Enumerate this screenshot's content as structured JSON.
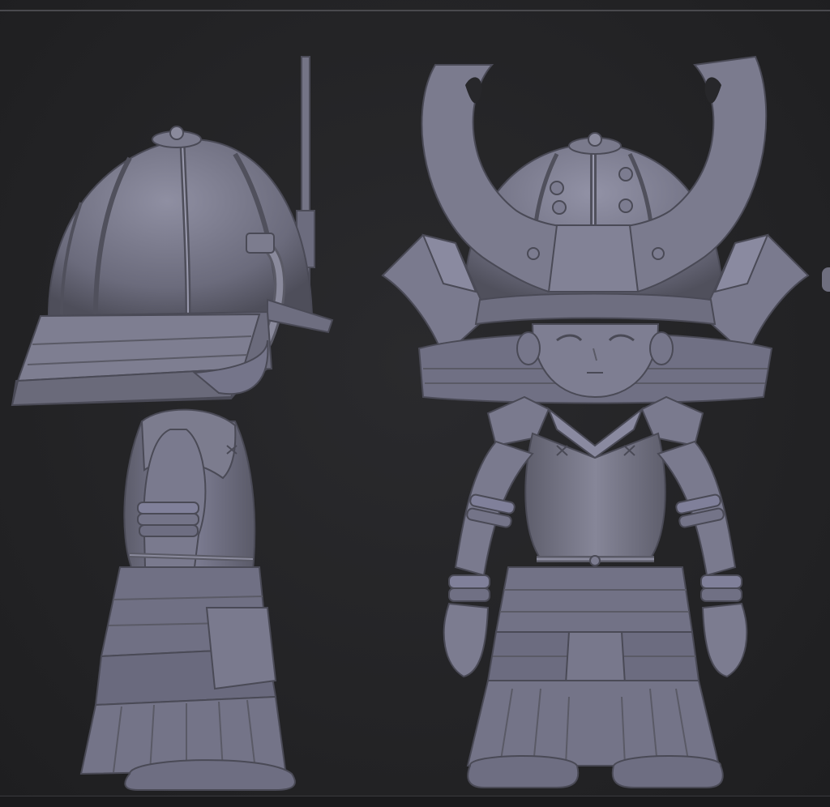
{
  "colors": {
    "background": "#252527",
    "clay_base": "#757586",
    "clay_light": "#9a9aab",
    "clay_dark": "#4a4a56",
    "clay_shadow": "#3a3a44"
  },
  "viewport": {
    "views": [
      {
        "id": "side",
        "icon": "samurai-side-view-sculpt"
      },
      {
        "id": "front",
        "icon": "samurai-front-view-sculpt"
      }
    ]
  }
}
